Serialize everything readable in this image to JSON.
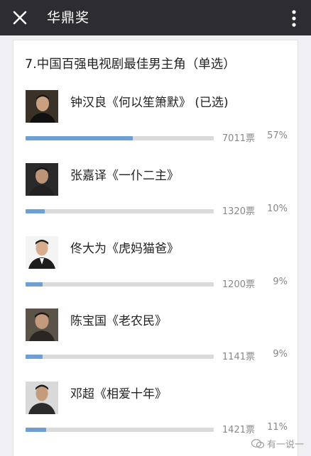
{
  "header": {
    "title": "华鼎奖",
    "close_icon": "close-icon",
    "more_icon": "more-vertical-icon"
  },
  "poll": {
    "question": "7.中国百强电视剧最佳男主角（单选）",
    "options": [
      {
        "label": "钟汉良《何以笙箫默》 (已选)",
        "votes": "7011票",
        "percent": "57%",
        "fill": 0.57
      },
      {
        "label": "张嘉译《一仆二主》",
        "votes": "1320票",
        "percent": "10%",
        "fill": 0.1
      },
      {
        "label": "佟大为《虎妈猫爸》",
        "votes": "1200票",
        "percent": "9%",
        "fill": 0.09
      },
      {
        "label": "陈宝国《老农民》",
        "votes": "1141票",
        "percent": "9%",
        "fill": 0.09
      },
      {
        "label": "邓超《相爱十年》",
        "votes": "1421票",
        "percent": "11%",
        "fill": 0.11
      }
    ]
  },
  "watermark": {
    "text": "有一说一"
  },
  "colors": {
    "topbar": "#2d2d31",
    "bar_fill": "#6e9fd1",
    "bar_track": "#dadada",
    "background": "#efeff4"
  }
}
